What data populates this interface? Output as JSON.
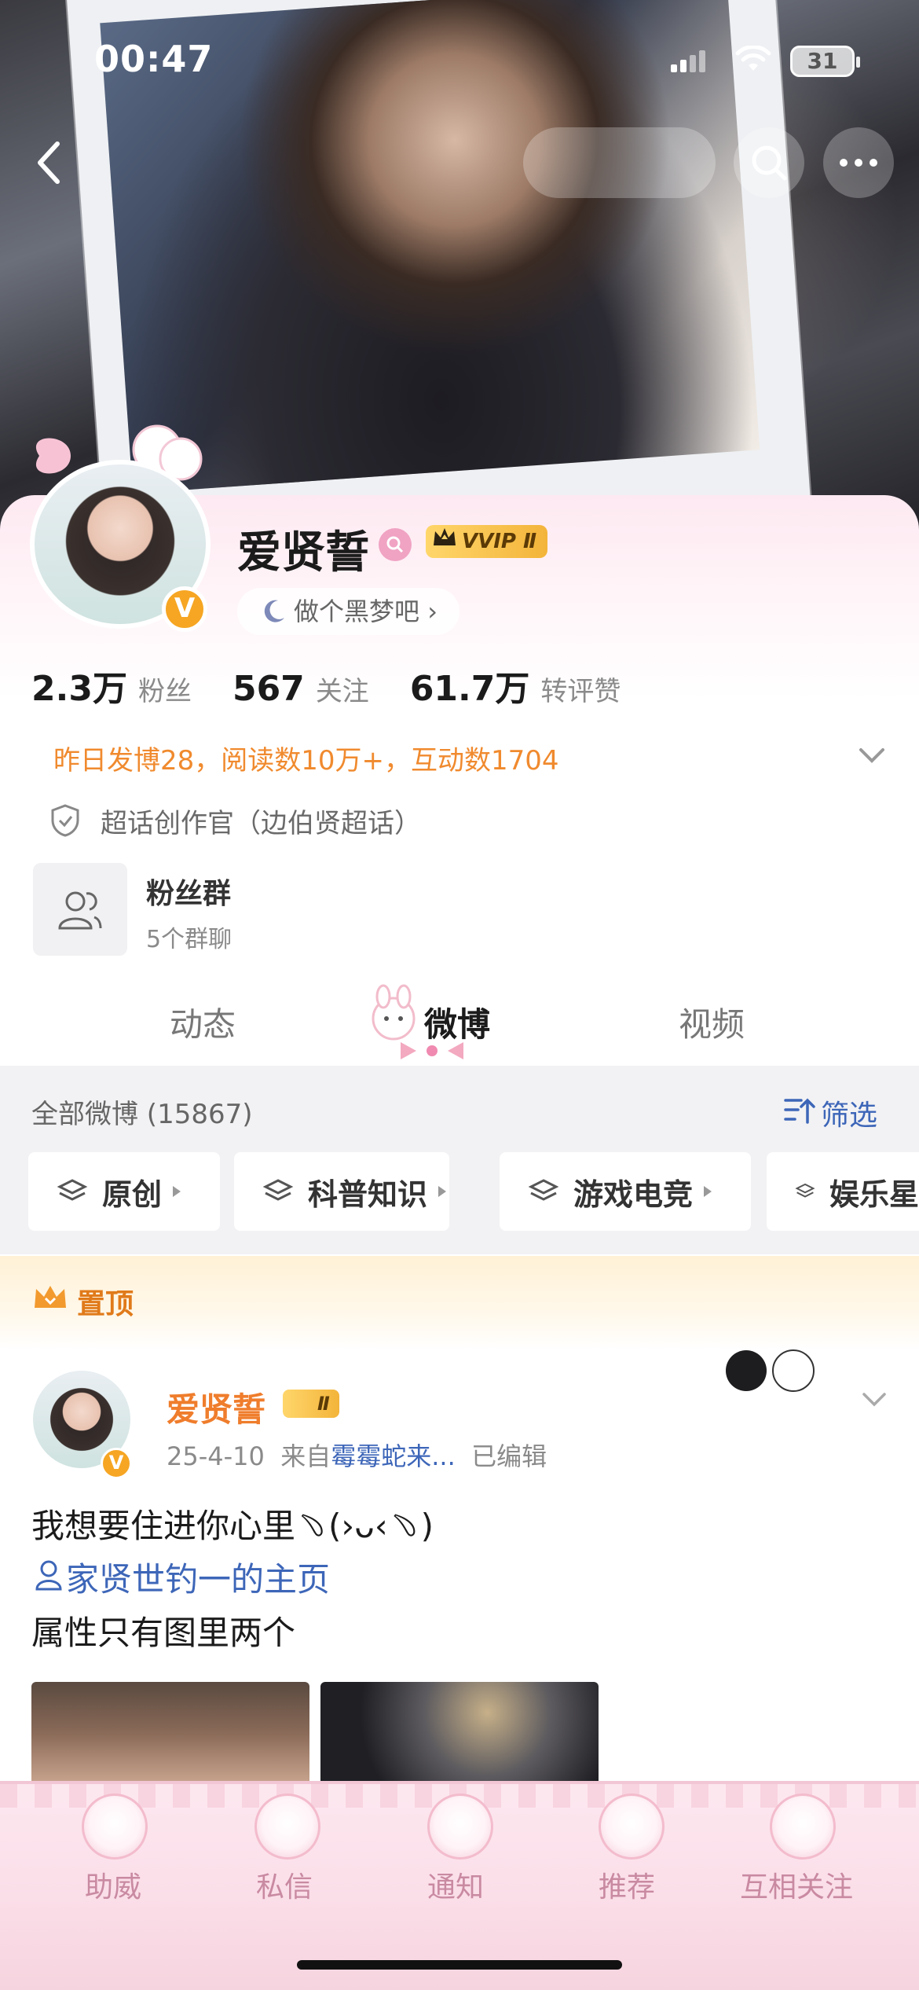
{
  "status_bar": {
    "time": "00:47",
    "battery": "31"
  },
  "profile": {
    "name": "爱贤誓",
    "vip_badge": "VVIP Ⅱ",
    "status_tag": "做个黑梦吧",
    "verify_mark": "V",
    "stats": [
      {
        "num": "2.3万",
        "label": "粉丝"
      },
      {
        "num": "567",
        "label": "关注"
      },
      {
        "num": "61.7万",
        "label": "转评赞"
      }
    ],
    "activity": "昨日发博28，阅读数10万+，互动数1704",
    "super_topic": "超话创作官（边伯贤超话）",
    "group": {
      "title": "粉丝群",
      "sub": "5个群聊"
    }
  },
  "tabs": [
    {
      "label": "动态"
    },
    {
      "label": "微博"
    },
    {
      "label": "视频"
    }
  ],
  "feed": {
    "all_label": "全部微博 (15867)",
    "filter_label": "筛选",
    "chips": [
      {
        "label": "原创"
      },
      {
        "label": "科普知识"
      },
      {
        "label": "游戏电竞"
      },
      {
        "label": "娱乐星"
      }
    ],
    "pinned_label": "置顶"
  },
  "post": {
    "name": "爱贤誓",
    "vip_badge": "Ⅱ",
    "date": "25-4-10",
    "from": "来自",
    "source": "霉霉蛇来...",
    "edited": "已编辑",
    "line1": "我想要住进你心里﹆(›ᴗ‹﹆)",
    "mention": "家贤世钓一的主页",
    "line3": "属性只有图里两个"
  },
  "bottom_nav": [
    {
      "label": "助威"
    },
    {
      "label": "私信"
    },
    {
      "label": "通知"
    },
    {
      "label": "推荐"
    },
    {
      "label": "互相关注"
    }
  ],
  "colors": {
    "accent_orange": "#ef7d2c",
    "link_blue": "#3d66b8",
    "vip_gold": "#f3b43a",
    "pink_theme": "#fde9f1"
  }
}
